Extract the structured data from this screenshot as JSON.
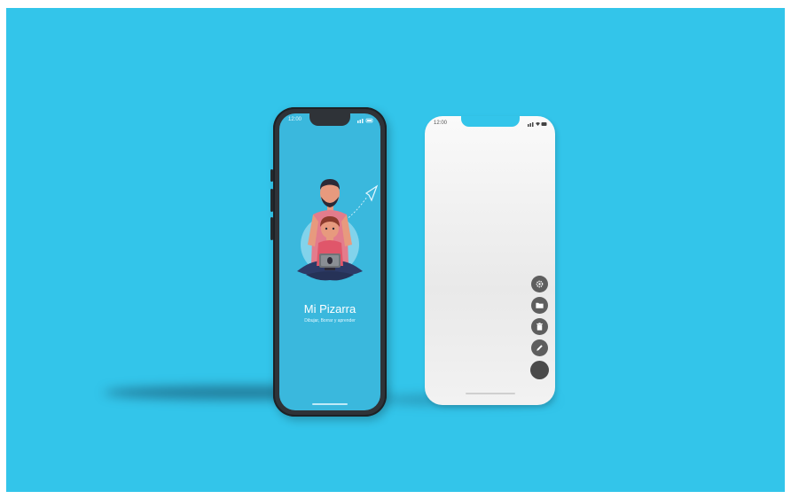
{
  "left_phone": {
    "status_time": "12:00",
    "app_title": "Mi Pizarra",
    "app_subtitle": "Dibujar, Borrar y aprender"
  },
  "right_phone": {
    "status_time": "12:00",
    "toolbar": [
      {
        "icon": "gear-icon",
        "label": "Settings"
      },
      {
        "icon": "folder-icon",
        "label": "Folder"
      },
      {
        "icon": "trash-icon",
        "label": "Delete"
      },
      {
        "icon": "pencil-icon",
        "label": "Draw"
      },
      {
        "icon": "color-swatch",
        "label": "Color"
      }
    ]
  },
  "colors": {
    "background": "#33c5ea",
    "app_screen": "#3ab8dd",
    "toolbar_button": "#5e5e5e",
    "color_swatch": "#4a4a4a"
  }
}
